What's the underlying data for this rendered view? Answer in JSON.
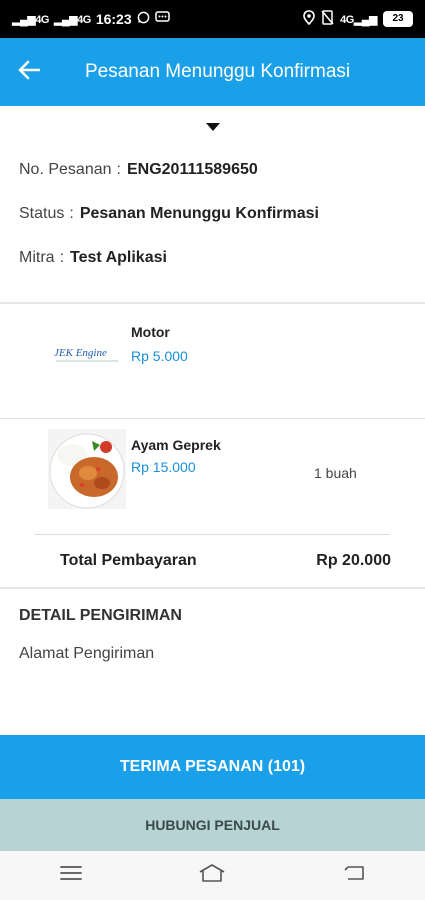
{
  "status_bar": {
    "time": "16:23",
    "signal_1": "4G",
    "signal_2": "4G",
    "network": "4G",
    "battery": "23",
    "icons": [
      "whatsapp-icon",
      "message-icon",
      "location-icon",
      "no-sim-icon",
      "vibrate-icon"
    ]
  },
  "app_bar": {
    "back_icon": "arrow-left-icon",
    "title": "Pesanan Menunggu Konfirmasi"
  },
  "order": {
    "collapse_icon": "caret-down-icon",
    "rows": [
      {
        "label": "No. Pesanan",
        "colon": ":",
        "value": "ENG20111589650"
      },
      {
        "label": "Status",
        "colon": ":",
        "value": "Pesanan Menunggu Konfirmasi"
      },
      {
        "label": "Mitra",
        "colon": ":",
        "value": "Test Aplikasi"
      }
    ]
  },
  "items": [
    {
      "name": "Motor",
      "price": "Rp 5.000",
      "qty": "",
      "image": "jek-engine-logo",
      "logo_text": "JEK Engine"
    },
    {
      "name": "Ayam Geprek",
      "price": "Rp 15.000",
      "qty": "1 buah",
      "image": "ayam-geprek-photo"
    }
  ],
  "total": {
    "label": "Total Pembayaran",
    "amount": "Rp 20.000"
  },
  "shipping": {
    "title": "DETAIL PENGIRIMAN",
    "address_label": "Alamat Pengiriman"
  },
  "actions": {
    "accept_label": "TERIMA PESANAN (101)",
    "contact_label": "HUBUNGI PENJUAL"
  },
  "nav": {
    "icons": [
      "menu-icon",
      "home-icon",
      "back-icon"
    ]
  },
  "colors": {
    "primary": "#1aa0e8",
    "secondary_button": "#b8d3d3",
    "price": "#1a8fd6"
  }
}
